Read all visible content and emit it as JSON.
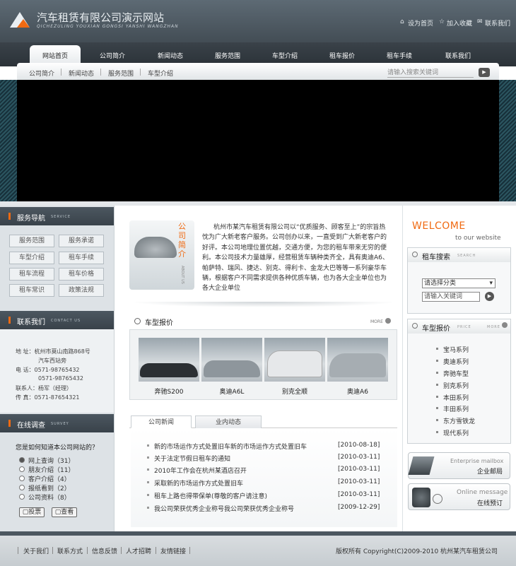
{
  "header": {
    "title": "汽车租赁有限公司演示网站",
    "subtitle": "QICHEZULING YOUXIAN GONGSI YANSHI WANGZHAN",
    "links": [
      "设为首页",
      "加入收藏",
      "联系我们"
    ]
  },
  "nav": {
    "items": [
      "网站首页",
      "公司简介",
      "新闻动态",
      "服务范围",
      "车型介绍",
      "租车报价",
      "租车手续",
      "联系我们"
    ]
  },
  "subnav": {
    "items": [
      "公司简介",
      "新闻动态",
      "服务范围",
      "车型介绍"
    ],
    "search_placeholder": "请输入搜索关键词"
  },
  "left": {
    "service": {
      "title": "服务导航",
      "en": "SERVICE",
      "buttons": [
        "服务范围",
        "服务承诺",
        "车型介绍",
        "租车手续",
        "租车流程",
        "租车价格",
        "租车常识",
        "政策法规"
      ]
    },
    "contact": {
      "title": "联系我们",
      "en": "CONTACT US",
      "lines": [
        "地  址：杭州市莫山南路868号",
        "汽车西站旁",
        "电  话：0571-98765432",
        "0571-98765432",
        "联系人：杨军（经理）",
        "传  真：0571-87654321"
      ]
    },
    "survey": {
      "title": "在线调查",
      "en": "SURVEY",
      "question": "您是如何知道本公司网站的？",
      "options": [
        "网上查询（31）",
        "朋友介绍（11）",
        "客户介绍（4）",
        "报纸看到（2）",
        "公司资料（8）"
      ],
      "vote": "投票",
      "view": "查看"
    }
  },
  "intro": {
    "stamp": "公司简介",
    "stamp_en": "ABOUT US",
    "text": "杭州市某汽车租赁有限公司以“优质服务、顾客至上”的宗旨热忱为广大新老客户服务。公司创办以来，一直受到广大新老客户的好评。本公司地理位置优越，交通方便，为您的租车带来无穷的便利。本公司技术力量雄厚，经营租赁车辆种类齐全，具有奥迪A6、帕萨特、瑞风、捷达、别克、得利卡、金龙大巴等等一系列豪华车辆，根据客户不同需求提供各种优质车辆，也为各大企业单位也为各大企业单位"
  },
  "gallery": {
    "title": "车型报价",
    "more": "MORE",
    "cars": [
      "奔驰S200",
      "奥迪A6L",
      "别克全顺",
      "奥迪A6"
    ]
  },
  "news": {
    "tabs": [
      "公司新闻",
      "业内动态"
    ],
    "items": [
      {
        "title": "新的市场运作方式处置旧车新的市场运作方式处置旧车",
        "date": "[2010-08-18]"
      },
      {
        "title": "关于法定节假日租车的通知",
        "date": "[2010-03-11]"
      },
      {
        "title": "2010年工作会在杭州某酒店召开",
        "date": "[2010-03-11]"
      },
      {
        "title": "采取新的市场运作方式处置旧车",
        "date": "[2010-03-11]"
      },
      {
        "title": "租车上路也得带保单(尊敬的客户请注意)",
        "date": "[2010-03-11]"
      },
      {
        "title": "我公司荣获优秀企业称号我公司荣获优秀企业称号",
        "date": "[2009-12-29]"
      }
    ]
  },
  "right": {
    "welcome": "WELCOME",
    "welcome_sub": "to our website",
    "search": {
      "title": "租车搜索",
      "en": "SEARCH",
      "select": "请选择分类",
      "placeholder": "请输入关键词"
    },
    "price": {
      "title": "车型报价",
      "en": "PRICE",
      "more": "MORE",
      "series": [
        "宝马系列",
        "奥迪系列",
        "奔驰车型",
        "别克系列",
        "本田系列",
        "丰田系列",
        "东方雪铁龙",
        "现代系列"
      ]
    },
    "promo1": {
      "en": "Enterprise mailbox",
      "cn": "企业邮局"
    },
    "promo2": {
      "en": "Online message",
      "cn": "在线预订"
    }
  },
  "footer": {
    "links": [
      "关于我们",
      "联系方式",
      "信息反馈",
      "人才招聘",
      "友情链接"
    ],
    "copyright": "版权所有 Copyright(C)2009-2010 杭州某汽车租赁公司"
  }
}
